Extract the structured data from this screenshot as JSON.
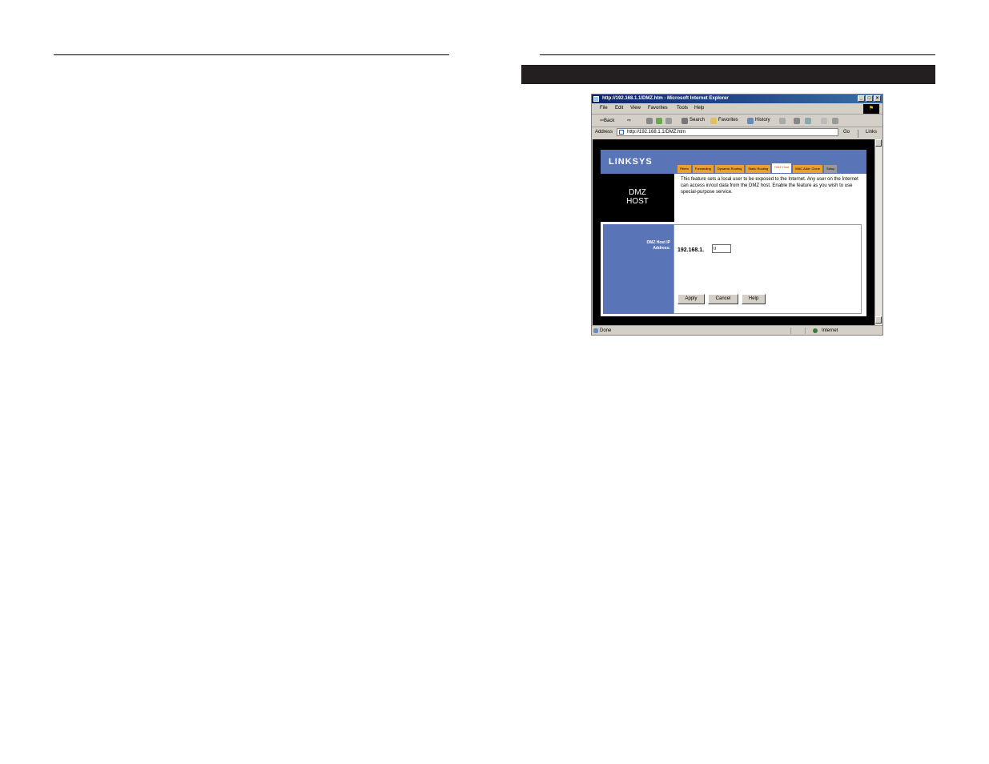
{
  "browser": {
    "title": "http://192.168.1.1/DMZ.htm - Microsoft Internet Explorer",
    "window_buttons": [
      "_",
      "□",
      "×"
    ],
    "menu": [
      "File",
      "Edit",
      "View",
      "Favorites",
      "Tools",
      "Help"
    ],
    "toolbar": {
      "back": "⇦Back",
      "forward": "⇨",
      "search": "Search",
      "favorites": "Favorites",
      "history": "History"
    },
    "address_label": "Address",
    "address_value": "http://192.168.1.1/DMZ.htm",
    "go": "Go",
    "links": "Links",
    "status_left": "Done",
    "status_right": "Internet"
  },
  "router": {
    "logo": "LINKSYS",
    "tabs": [
      "Filters",
      "Forwarding",
      "Dynamic Routing",
      "Static Routing",
      "DMZ Host",
      "MAC Addr. Clone",
      "Setup"
    ],
    "active_tab": "DMZ Host",
    "section_title": "DMZ HOST",
    "description": "This feature sets a local user to be exposed to the Internet. Any user on the Internet can access in/out data from the DMZ host. Enable the feature as you wish to use special-purpose service.",
    "field_label": "DMZ Host IP Address:",
    "ip_prefix": "192.168.1.",
    "ip_value": "0",
    "buttons": {
      "apply": "Apply",
      "cancel": "Cancel",
      "help": "Help"
    }
  },
  "colors": {
    "linksys_blue": "#5a74b8",
    "tab_orange": "#e8a030",
    "black_bar": "#231f20"
  }
}
